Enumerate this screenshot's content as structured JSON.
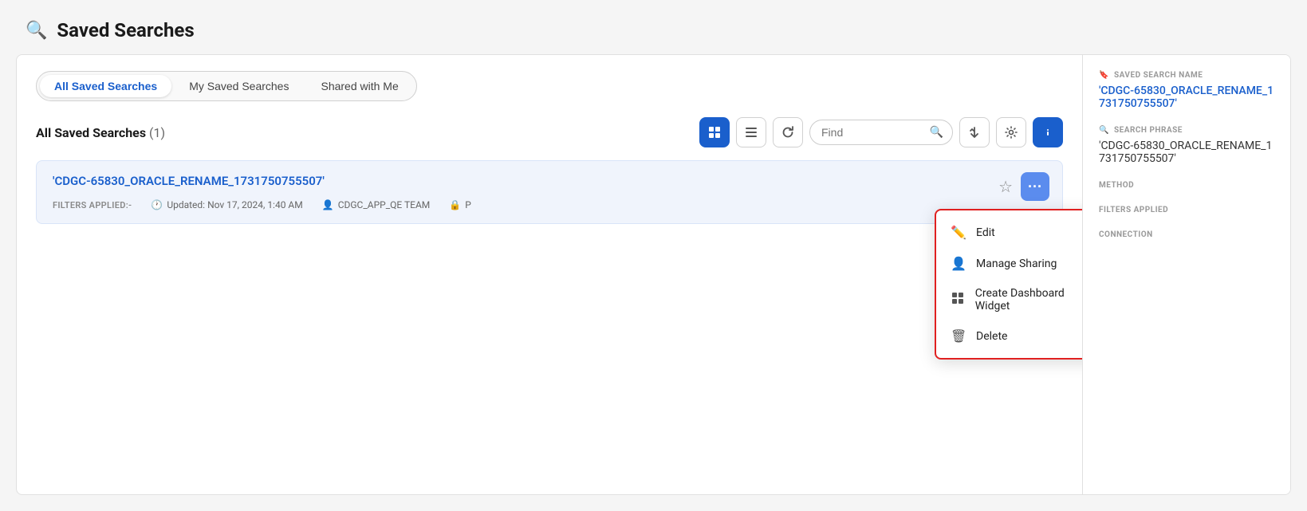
{
  "page": {
    "title": "Saved Searches",
    "title_icon": "🔍"
  },
  "tabs": [
    {
      "id": "all",
      "label": "All Saved Searches",
      "active": true
    },
    {
      "id": "my",
      "label": "My Saved Searches",
      "active": false
    },
    {
      "id": "shared",
      "label": "Shared with Me",
      "active": false
    }
  ],
  "section": {
    "title": "All Saved Searches",
    "count": "(1)"
  },
  "toolbar": {
    "find_placeholder": "Find",
    "grid_view_label": "Grid View",
    "table_view_label": "Table View",
    "refresh_label": "Refresh",
    "sort_label": "Sort",
    "settings_label": "Settings",
    "info_label": "Info"
  },
  "result_card": {
    "title": "'CDGC-65830_ORACLE_RENAME_1731750755507'",
    "filters_label": "FILTERS APPLIED:-",
    "updated_label": "Updated: Nov 17, 2024, 1:40 AM",
    "owner": "CDGC_APP_QE TEAM",
    "privacy": "P"
  },
  "dropdown_menu": {
    "items": [
      {
        "id": "edit",
        "label": "Edit",
        "icon": "✏️"
      },
      {
        "id": "manage-sharing",
        "label": "Manage Sharing",
        "icon": "👤"
      },
      {
        "id": "create-dashboard-widget",
        "label": "Create Dashboard Widget",
        "icon": "⊞"
      },
      {
        "id": "delete",
        "label": "Delete",
        "icon": "🗑"
      }
    ]
  },
  "right_panel": {
    "saved_search_name_label": "SAVED SEARCH NAME",
    "saved_search_name_value": "'CDGC-65830_ORACLE_RENAME_1731750755507'",
    "search_phrase_label": "SEARCH PHRASE",
    "search_phrase_value": "'CDGC-65830_ORACLE_RENAME_1731750755507'",
    "method_label": "METHOD",
    "filters_applied_label": "FILTERS APPLIED",
    "connection_label": "CONNECTION"
  }
}
